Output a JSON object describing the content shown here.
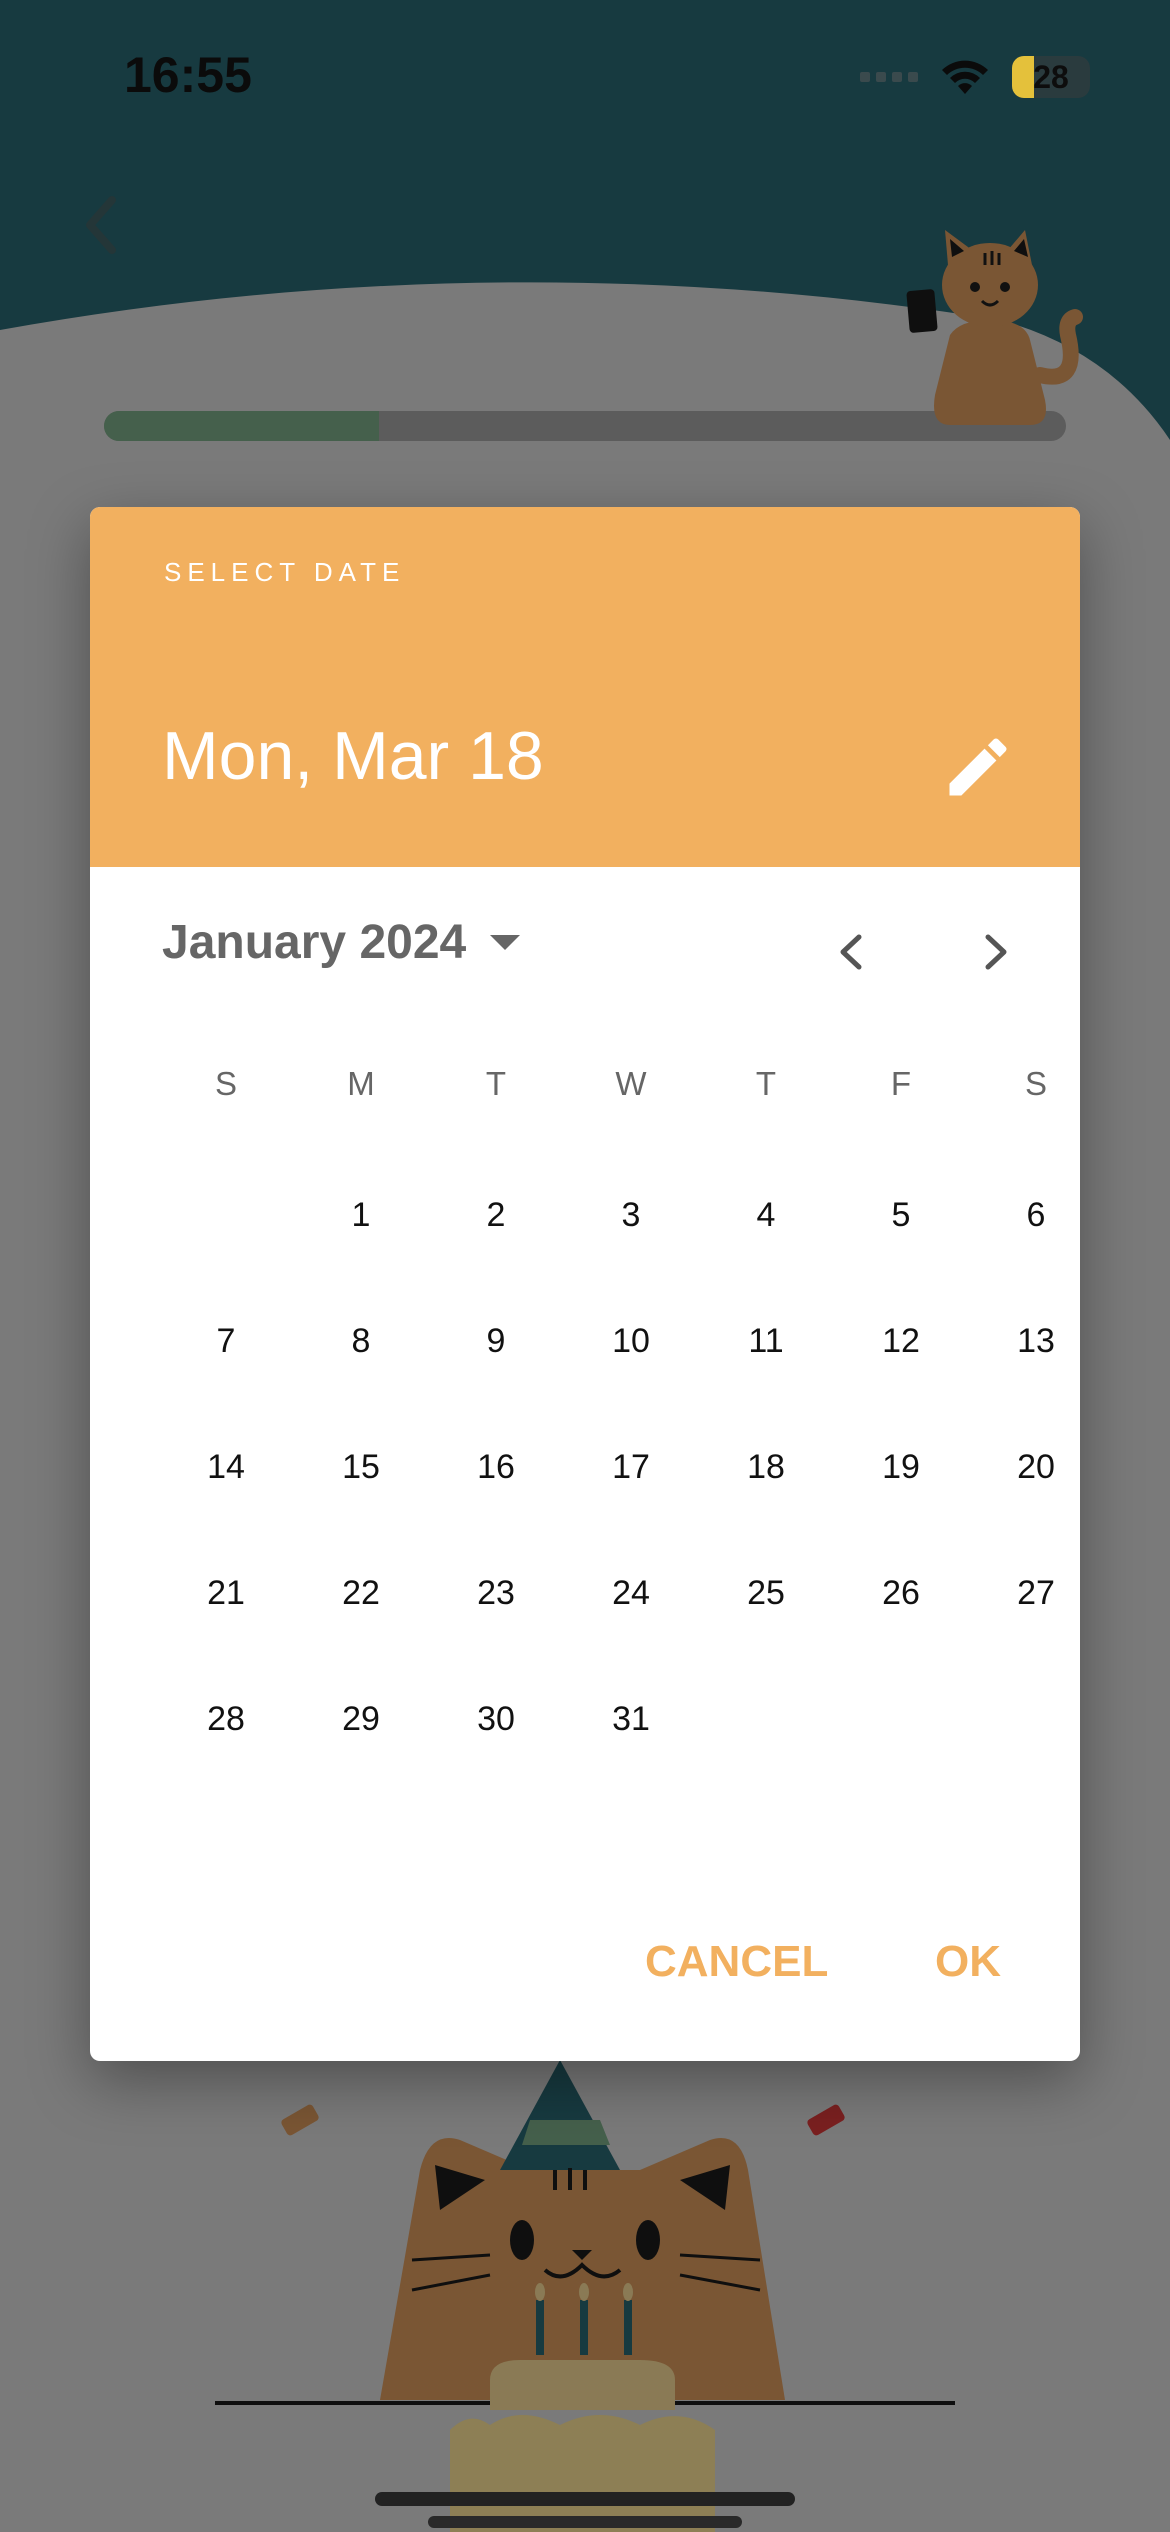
{
  "status_bar": {
    "time": "16:55",
    "battery": "28"
  },
  "progress": {
    "value": 0.286
  },
  "dialog": {
    "overline": "SELECT DATE",
    "selected_date": "Mon, Mar 18",
    "month_year": "January 2024",
    "weekdays": [
      "S",
      "M",
      "T",
      "W",
      "T",
      "F",
      "S"
    ],
    "days": [
      "1",
      "2",
      "3",
      "4",
      "5",
      "6",
      "7",
      "8",
      "9",
      "10",
      "11",
      "12",
      "13",
      "14",
      "15",
      "16",
      "17",
      "18",
      "19",
      "20",
      "21",
      "22",
      "23",
      "24",
      "25",
      "26",
      "27",
      "28",
      "29",
      "30",
      "31"
    ],
    "first_day_offset": 1,
    "cancel_label": "CANCEL",
    "ok_label": "OK"
  },
  "icons": {
    "back": "chevron-left-icon",
    "edit": "pencil-icon",
    "dropdown": "arrow-drop-down-icon",
    "prev": "chevron-left-icon",
    "next": "chevron-right-icon"
  },
  "colors": {
    "header_accent": "#f2b05f",
    "top_background": "#173a40",
    "progress_fill": "#45604c"
  }
}
